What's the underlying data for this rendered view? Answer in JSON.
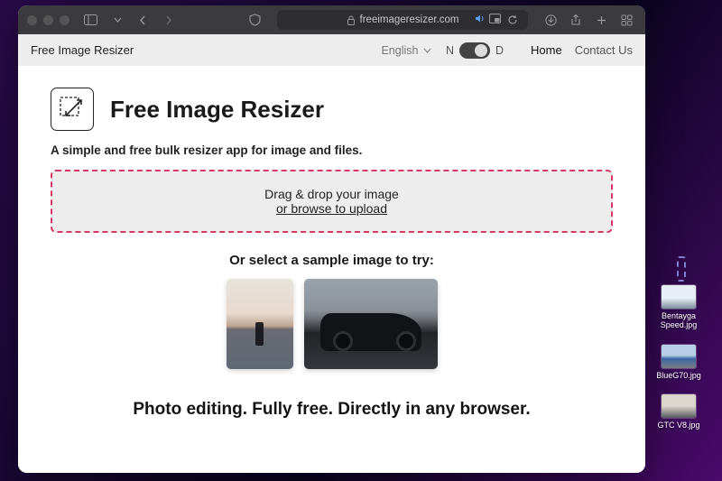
{
  "browser": {
    "url_host": "freeimageresizer.com"
  },
  "sitebar": {
    "brand": "Free Image Resizer",
    "language": "English",
    "theme_n": "N",
    "theme_d": "D",
    "nav_home": "Home",
    "nav_contact": "Contact Us"
  },
  "hero": {
    "title": "Free Image Resizer",
    "subtitle": "A simple and free bulk resizer app for image and files."
  },
  "drop": {
    "line1": "Drag & drop your image",
    "line2": "or browse to upload"
  },
  "samples": {
    "label": "Or select a sample image to try:"
  },
  "tagline": "Photo editing. Fully free. Directly in any browser.",
  "desktop_files": [
    {
      "name": "Bentayga Speed.jpg"
    },
    {
      "name": "BlueG70.jpg"
    },
    {
      "name": "GTC V8.jpg"
    }
  ]
}
